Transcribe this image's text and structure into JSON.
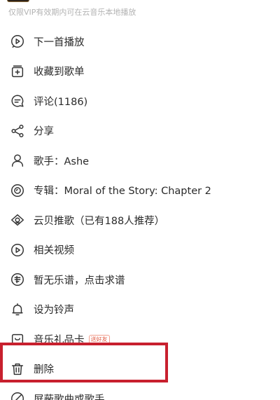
{
  "notice_text": "仅限VIP有效期内可在云音乐本地播放",
  "menu": [
    {
      "id": "next-play",
      "icon": "play-next-icon",
      "label": "下一首播放"
    },
    {
      "id": "collect",
      "icon": "add-to-playlist-icon",
      "label": "收藏到歌单"
    },
    {
      "id": "comment",
      "icon": "comment-icon",
      "label": "评论(1186)"
    },
    {
      "id": "share",
      "icon": "share-icon",
      "label": "分享"
    },
    {
      "id": "artist",
      "icon": "user-icon",
      "label": "歌手：Ashe"
    },
    {
      "id": "album",
      "icon": "album-icon",
      "label": "专辑：Moral of the Story: Chapter 2"
    },
    {
      "id": "recommend",
      "icon": "recommend-icon",
      "label": "云贝推歌（已有188人推荐）"
    },
    {
      "id": "video",
      "icon": "video-icon",
      "label": "相关视频"
    },
    {
      "id": "sheet",
      "icon": "sheet-music-icon",
      "label": "暂无乐谱，点击求谱"
    },
    {
      "id": "ringtone",
      "icon": "bell-icon",
      "label": "设为铃声"
    },
    {
      "id": "gift",
      "icon": "gift-card-icon",
      "label": "音乐礼品卡",
      "tag": "送好友"
    },
    {
      "id": "delete",
      "icon": "trash-icon",
      "label": "删除"
    },
    {
      "id": "block",
      "icon": "block-icon",
      "label": "屏蔽歌曲或歌手"
    }
  ],
  "colors": {
    "highlight": "#c8202e",
    "text": "#2a2a2a",
    "notice": "#b3b3b3",
    "tag": "#e0563e"
  }
}
